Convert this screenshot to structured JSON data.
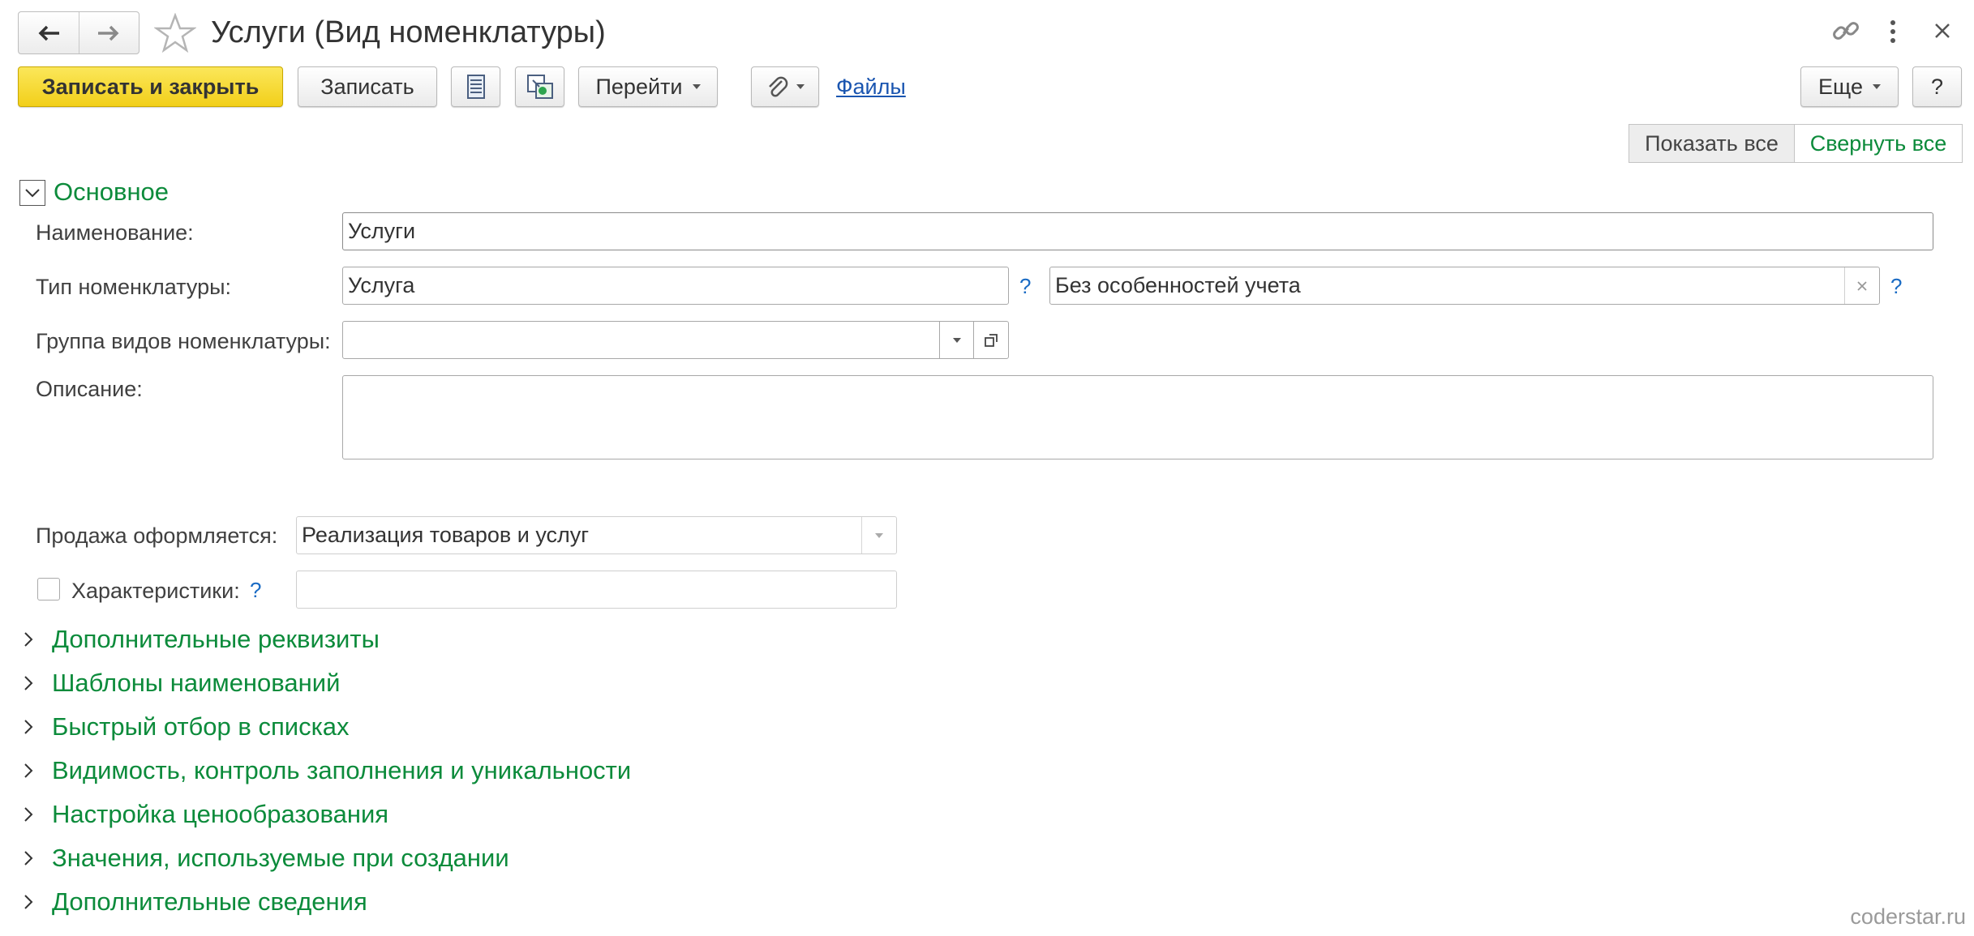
{
  "window": {
    "title": "Услуги (Вид номенклатуры)"
  },
  "toolbar": {
    "save_close_label": "Записать и закрыть",
    "save_label": "Записать",
    "goto_label": "Перейти",
    "files_link": "Файлы",
    "more_label": "Еще",
    "help_label": "?",
    "show_all_label": "Показать все",
    "collapse_all_label": "Свернуть все"
  },
  "form": {
    "main_group_title": "Основное",
    "name_label": "Наименование:",
    "name_value": "Услуги",
    "type_label": "Тип номенклатуры:",
    "type_value": "Услуга",
    "type_help": "?",
    "accounting_value": "Без особенностей учета",
    "accounting_help": "?",
    "group_label": "Группа видов номенклатуры:",
    "group_value": "",
    "description_label": "Описание:",
    "description_value": "",
    "sale_label": "Продажа оформляется:",
    "sale_value": "Реализация товаров и услуг",
    "characteristics_label": "Характеристики:",
    "characteristics_help": "?",
    "characteristics_value": ""
  },
  "sections": [
    "Дополнительные реквизиты",
    "Шаблоны наименований",
    "Быстрый отбор в списках",
    "Видимость, контроль заполнения и уникальности",
    "Настройка ценообразования",
    "Значения, используемые при создании",
    "Дополнительные сведения"
  ],
  "watermark": "coderstar.ru",
  "colors": {
    "section_green": "#0c8b3b",
    "primary_yellow": "#f2cf1a",
    "link_blue": "#1a55b0"
  },
  "icons": [
    "back-arrow-icon",
    "forward-arrow-icon",
    "star-icon",
    "link-icon",
    "more-vert-icon",
    "close-icon",
    "list-report-icon",
    "structure-icon",
    "paperclip-icon",
    "chevron-down-icon",
    "chevron-right-icon",
    "clear-icon",
    "open-icon"
  ]
}
